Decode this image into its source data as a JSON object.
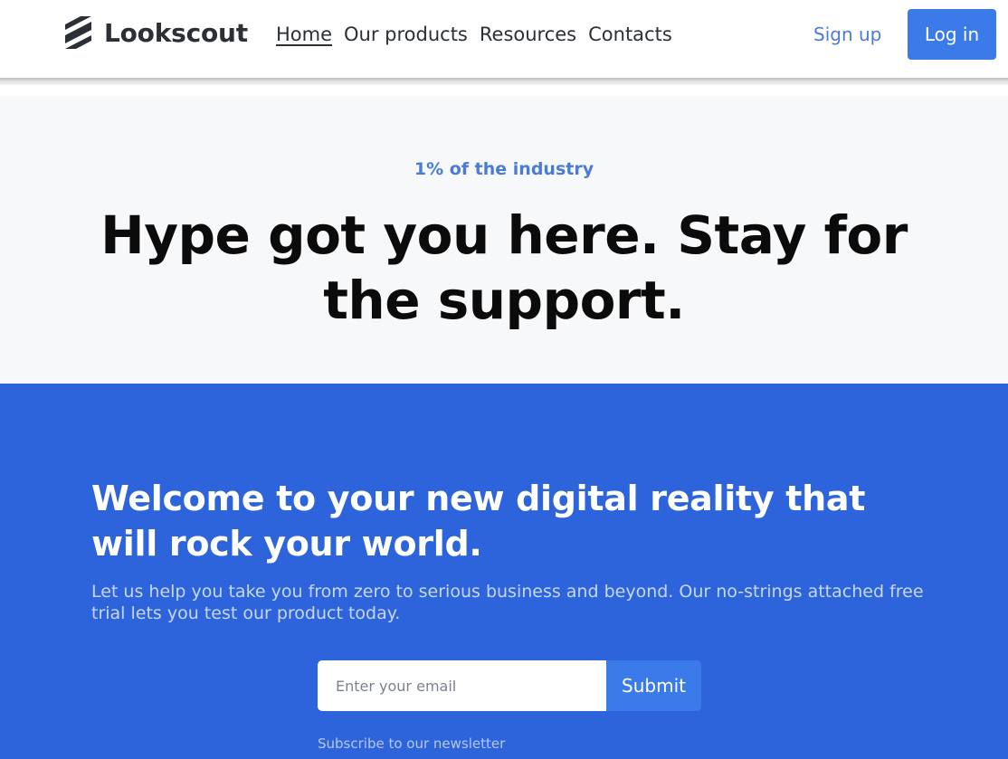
{
  "header": {
    "brand_name": "Lookscout",
    "brand_icon": "stacked-bars-logo-icon",
    "nav": [
      {
        "label": "Home",
        "active": true
      },
      {
        "label": "Our products",
        "active": false
      },
      {
        "label": "Resources",
        "active": false
      },
      {
        "label": "Contacts",
        "active": false
      }
    ],
    "signup_label": "Sign up",
    "login_label": "Log in"
  },
  "hero": {
    "eyebrow": "1% of the industry",
    "title": "Hype got you here. Stay for the support."
  },
  "cta": {
    "title": "Welcome to your new digital reality that will rock your world.",
    "description": "Let us help you take you from zero to serious business and beyond. Our no-strings attached free trial lets you test our product today.",
    "email_placeholder": "Enter your email",
    "email_value": "",
    "submit_label": "Submit",
    "note": "Subscribe to our newsletter"
  },
  "colors": {
    "accent": "#3b7be9",
    "cta_background": "#2d64db",
    "hero_background": "#f7f8fa",
    "link": "#4a7bd6"
  }
}
